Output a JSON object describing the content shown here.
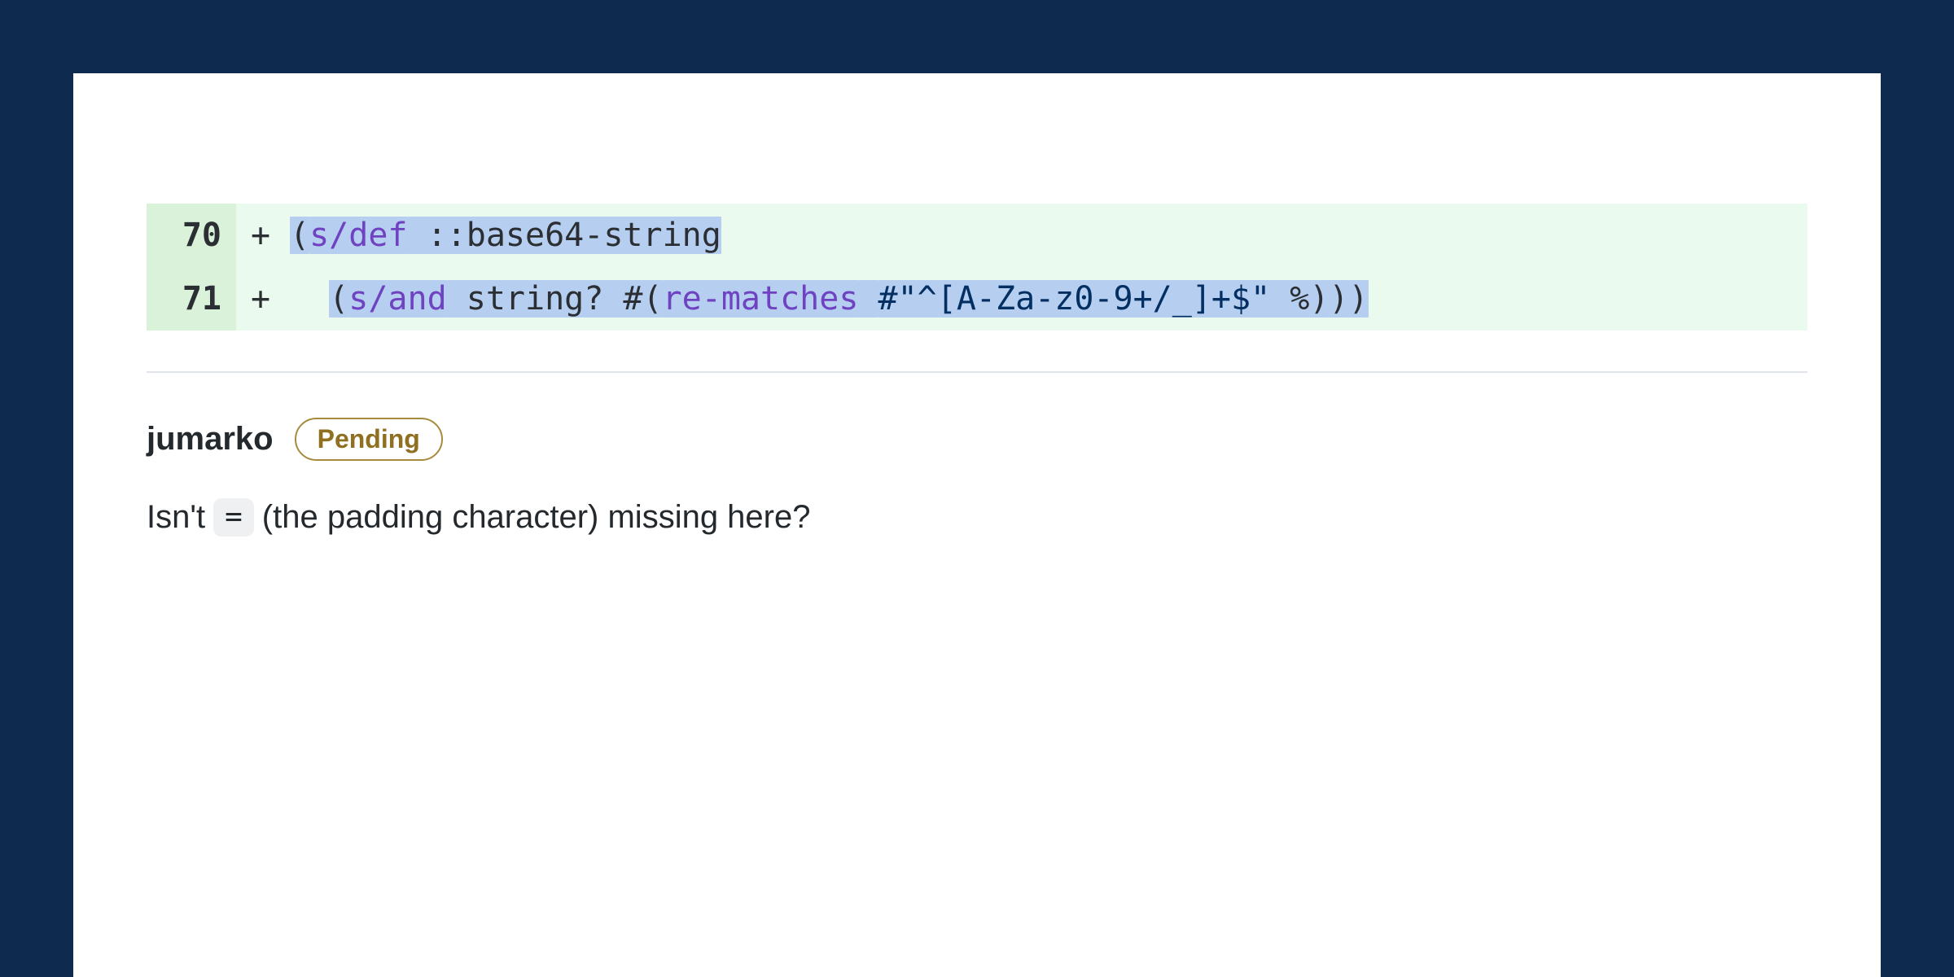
{
  "diff": {
    "lines": [
      {
        "number": "70",
        "marker": "+",
        "tokens": [
          {
            "cls": "sel",
            "text": "("
          },
          {
            "cls": "sel tok-fn",
            "text": "s/def"
          },
          {
            "cls": "sel",
            "text": " ::base64-string"
          }
        ]
      },
      {
        "number": "71",
        "marker": "+",
        "tokens": [
          {
            "cls": "",
            "text": "  "
          },
          {
            "cls": "sel",
            "text": "("
          },
          {
            "cls": "sel tok-fn",
            "text": "s/and"
          },
          {
            "cls": "sel",
            "text": " string? #("
          },
          {
            "cls": "sel tok-fn",
            "text": "re-matches"
          },
          {
            "cls": "sel",
            "text": " "
          },
          {
            "cls": "sel tok-str",
            "text": "#\"^[A-Za-z0-9+/_]+$\""
          },
          {
            "cls": "sel",
            "text": " %)))"
          }
        ]
      }
    ]
  },
  "comment": {
    "author": "jumarko",
    "status": "Pending",
    "body_pre": "Isn't",
    "code": "=",
    "body_post": "(the padding character) missing here?"
  }
}
